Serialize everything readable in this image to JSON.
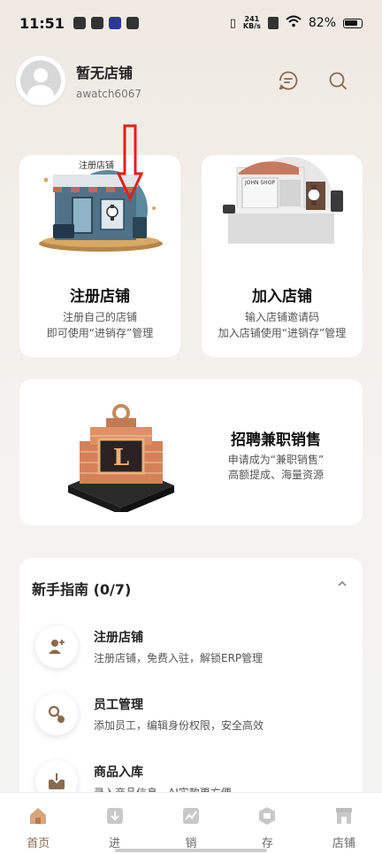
{
  "status_bar": {
    "time": "11:51",
    "net_speed_value": "241",
    "net_speed_unit": "KB/s",
    "battery": "82%"
  },
  "header": {
    "shop_name": "暂无店铺",
    "user_id": "awatch6067",
    "message_icon": "message-icon",
    "search_icon": "search-icon"
  },
  "cards": {
    "register": {
      "title": "注册店铺",
      "desc_line1": "注册自己的店铺",
      "desc_line2": "即可使用“进销存”管理",
      "sign": "注册店铺"
    },
    "join": {
      "title": "加入店铺",
      "desc_line1": "输入店铺邀请码",
      "desc_line2": "加入店铺使用“进销存”管理",
      "sign": "JOHN SHOP"
    },
    "recruit": {
      "title": "招聘兼职销售",
      "desc_line1": "申请成为“兼职销售”",
      "desc_line2": "高额提成、海量资源",
      "logo_letter": "L"
    }
  },
  "guide": {
    "title": "新手指南 (0/7)",
    "items": [
      {
        "name": "注册店铺",
        "sub": "注册店铺，免费入驻，解锁ERP管理",
        "icon": "add-user-icon"
      },
      {
        "name": "员工管理",
        "sub": "添加员工，编辑身份权限，安全高效",
        "icon": "staff-key-icon"
      },
      {
        "name": "商品入库",
        "sub": "录入商品信息，AI实款更方便",
        "icon": "inbox-download-icon"
      }
    ]
  },
  "tabs": [
    {
      "label": "首页",
      "icon": "home-icon",
      "active": true
    },
    {
      "label": "进",
      "icon": "stock-in-icon",
      "active": false
    },
    {
      "label": "销",
      "icon": "sales-chart-icon",
      "active": false
    },
    {
      "label": "存",
      "icon": "inventory-icon",
      "active": false
    },
    {
      "label": "店铺",
      "icon": "shop-icon",
      "active": false
    }
  ],
  "colors": {
    "accent": "#8a6a4e",
    "arrow": "#e0201c"
  }
}
